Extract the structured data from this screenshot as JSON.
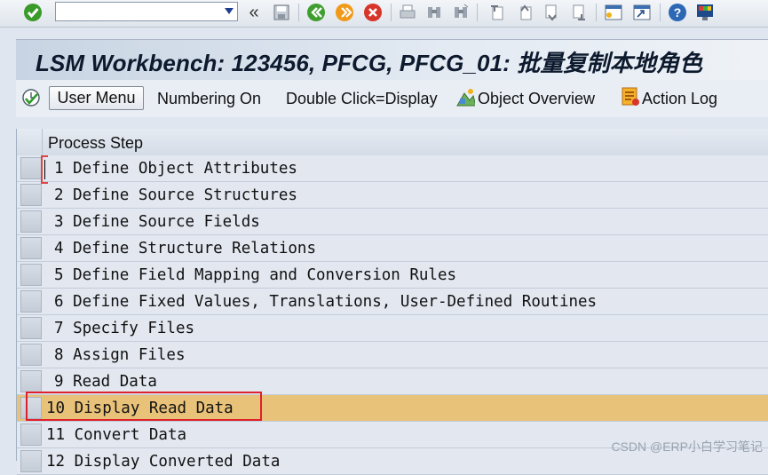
{
  "toolbar": {
    "icons": [
      "enter-icon",
      "back-icon",
      "save-icon",
      "back-green-icon",
      "exit-icon",
      "cancel-icon",
      "print-icon",
      "find-icon",
      "find-next-icon",
      "first-page-icon",
      "prev-page-icon",
      "next-page-icon",
      "last-page-icon",
      "new-session-icon",
      "shortcut-icon",
      "help-icon",
      "customize-layout-icon"
    ],
    "command_value": ""
  },
  "title": "LSM Workbench: 123456, PFCG, PFCG_01: 批量复制本地角色",
  "app_toolbar": {
    "user_menu": "User Menu",
    "numbering_on": "Numbering On",
    "double_click": "Double Click=Display",
    "object_overview": "Object Overview",
    "action_log": "Action Log"
  },
  "table": {
    "header": "Process Step",
    "rows": [
      "1 Define Object Attributes",
      "2 Define Source Structures",
      "3 Define Source Fields",
      "4 Define Structure Relations",
      "5 Define Field Mapping and Conversion Rules",
      "6 Define Fixed Values, Translations, User-Defined Routines",
      "7 Specify Files",
      "8 Assign Files",
      "9 Read Data",
      "10 Display Read Data",
      "11 Convert Data",
      "12 Display Converted Data"
    ]
  },
  "watermark": "CSDN @ERP小白学习笔记",
  "colors": {
    "highlight_row": "#e9c27a",
    "annotation_box": "#e0202a"
  }
}
